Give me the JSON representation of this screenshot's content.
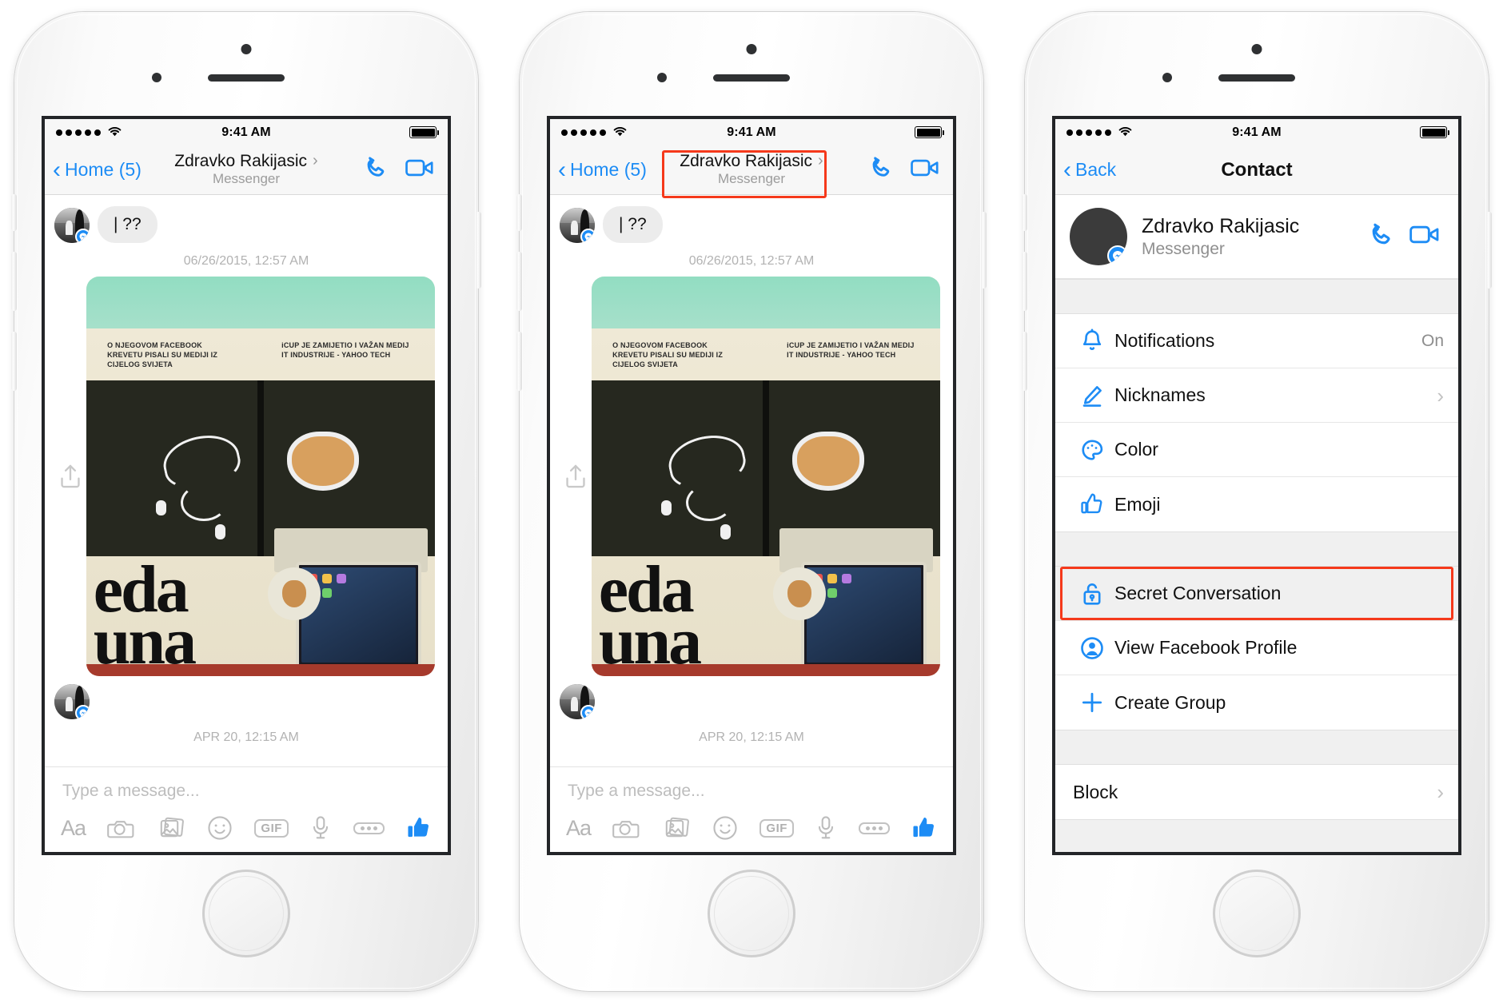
{
  "statusbar": {
    "time": "9:41 AM",
    "signal_dots": 5,
    "wifi": "wifi-icon",
    "battery": "battery-full-icon"
  },
  "phone1": {
    "nav": {
      "back_label": "Home (5)",
      "title": "Zdravko Rakijasic",
      "subtitle": "Messenger",
      "chevron": "›",
      "call_icon": "phone-call-icon",
      "video_icon": "video-camera-icon"
    },
    "conversation": {
      "message": "| ??",
      "photo_timestamp": "06/26/2015, 12:57 AM",
      "bottom_timestamp": "APR 20, 12:15 AM",
      "share_icon": "share-upload-icon",
      "photo_caption_left": "O NJEGOVOM FACEBOOK KREVETU PISALI SU MEDIJI IZ CIJELOG SVIJETA",
      "photo_caption_right": "iCUP JE ZAMIJETIO I VAŽAN MEDIJ IT INDUSTRIJE - YAHOO TECH",
      "photo_big_text_1": "eda",
      "photo_big_text_2": "una"
    },
    "composer": {
      "placeholder": "Type a message...",
      "tools": [
        {
          "name": "text-format-icon",
          "label": "Aa"
        },
        {
          "name": "camera-icon",
          "label": ""
        },
        {
          "name": "photo-library-icon",
          "label": ""
        },
        {
          "name": "emoji-smiley-icon",
          "label": ""
        },
        {
          "name": "gif-icon",
          "label": "GIF"
        },
        {
          "name": "microphone-icon",
          "label": ""
        },
        {
          "name": "more-options-icon",
          "label": ""
        },
        {
          "name": "thumbs-up-icon",
          "label": ""
        }
      ]
    }
  },
  "phone2": {
    "nav": {
      "back_label": "Home (5)",
      "title": "Zdravko Rakijasic",
      "subtitle": "Messenger",
      "chevron": "›"
    },
    "highlight": {
      "target": "conversation-title",
      "color": "#f5391b"
    }
  },
  "phone3": {
    "nav": {
      "back_label": "Back",
      "title": "Contact"
    },
    "contact": {
      "name": "Zdravko Rakijasic",
      "subtitle": "Messenger",
      "call_icon": "phone-call-icon",
      "video_icon": "video-camera-icon"
    },
    "group1": [
      {
        "icon": "bell-icon",
        "label": "Notifications",
        "value": "On",
        "chevron": false
      },
      {
        "icon": "pencil-icon",
        "label": "Nicknames",
        "value": "",
        "chevron": true
      },
      {
        "icon": "palette-icon",
        "label": "Color",
        "value": "",
        "chevron": false
      },
      {
        "icon": "thumbs-up-icon",
        "label": "Emoji",
        "value": "",
        "chevron": false
      }
    ],
    "group2": [
      {
        "icon": "lock-icon",
        "label": "Secret Conversation",
        "value": "",
        "chevron": false,
        "highlighted": true
      },
      {
        "icon": "person-circle-icon",
        "label": "View Facebook Profile",
        "value": "",
        "chevron": false
      },
      {
        "icon": "plus-icon",
        "label": "Create Group",
        "value": "",
        "chevron": false
      }
    ],
    "group3": [
      {
        "icon": "",
        "label": "Block",
        "value": "",
        "chevron": true
      }
    ],
    "highlight": {
      "target": "secret-conversation-row",
      "color": "#f5391b"
    }
  },
  "colors": {
    "accent": "#1d8cf5",
    "highlight": "#f5391b",
    "muted": "#8f8f8f",
    "chrome": "#f7f7f7"
  }
}
